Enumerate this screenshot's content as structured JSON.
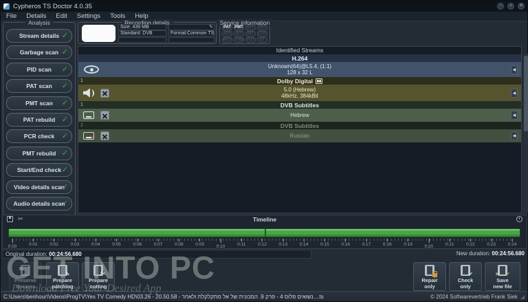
{
  "window": {
    "title": "Cypheros TS Doctor 4.0.35",
    "controls": {
      "minimize": "−",
      "maximize": "+",
      "close": "✕"
    }
  },
  "menu": [
    "File",
    "Details",
    "Edit",
    "Settings",
    "Tools",
    "Help"
  ],
  "analysis": {
    "title": "Analysis",
    "buttons": [
      "Stream details",
      "Garbage scan",
      "PID scan",
      "PAT scan",
      "PMT scan",
      "PAT rebuild",
      "PCR check",
      "PMT rebuild",
      "Start/End check",
      "Video details scan",
      "Audio details scan"
    ]
  },
  "recording": {
    "title": "Recording details",
    "size": "Size:  439 MB",
    "standard": "Standard: DVB",
    "format": "Format:Common TS"
  },
  "service": {
    "title": "Service information",
    "badges": [
      {
        "label": "PAT",
        "state": "on"
      },
      {
        "label": "PMT",
        "state": "on"
      },
      {
        "label": "EIT"
      },
      {
        "label": "SDT"
      },
      {
        "label": "TDT"
      },
      {
        "label": "SIT"
      },
      {
        "label": "NIT"
      },
      {
        "label": "CAT"
      },
      {
        "label": "RST"
      },
      {
        "label": "TSD"
      },
      {
        "label": "TOT"
      },
      {
        "label": "ST"
      }
    ]
  },
  "streams": {
    "panel_title": "Identified Streams",
    "video": {
      "codec": "H.264",
      "line1": "Unknown(64)@L5.4,  (1:1)",
      "line2": "128 x 32 L"
    },
    "audio": {
      "index": "1",
      "codec": "Dolby Digital",
      "line1": "5.0 (Hebrew)",
      "line2": "48kHz, 384kBit"
    },
    "sub1": {
      "index": "1",
      "codec": "DVB Subtitles",
      "line1": "Hebrew"
    },
    "sub2": {
      "index": "2",
      "codec": "DVB Subtitles",
      "line1": "Russian"
    }
  },
  "timeline": {
    "title": "Timeline",
    "ticks": [
      {
        "label": "0:00",
        "state": "major"
      },
      {
        "label": "0:01"
      },
      {
        "label": "0:02"
      },
      {
        "label": "0:03"
      },
      {
        "label": "0:04"
      },
      {
        "label": "0:05"
      },
      {
        "label": "0:06"
      },
      {
        "label": "0:07"
      },
      {
        "label": "0:08"
      },
      {
        "label": "0:09"
      },
      {
        "label": "0:10",
        "state": "major"
      },
      {
        "label": "0:11"
      },
      {
        "label": "0:12"
      },
      {
        "label": "0:13"
      },
      {
        "label": "0:14"
      },
      {
        "label": "0:15"
      },
      {
        "label": "0:16"
      },
      {
        "label": "0:17"
      },
      {
        "label": "0:18"
      },
      {
        "label": "0:19"
      },
      {
        "label": "0:20",
        "state": "major"
      },
      {
        "label": "0:21"
      },
      {
        "label": "0:22"
      },
      {
        "label": "0:23"
      },
      {
        "label": "0:24"
      }
    ]
  },
  "durations": {
    "original_label": "Original duration:",
    "original_value": "00:24:56.680",
    "new_label": "New duration:",
    "new_value": "00:24:56.680"
  },
  "actions": {
    "preserve": {
      "l1": "Preserve",
      "l2": "streams"
    },
    "patching": {
      "l1": "Prepare",
      "l2": "patching"
    },
    "cutting": {
      "l1": "Prepare",
      "l2": "cutting"
    },
    "repair": {
      "l1": "Repair",
      "l2": "only"
    },
    "check": {
      "l1": "Check",
      "l2": "only"
    },
    "save": {
      "l1": "Save",
      "l2": "new file"
    }
  },
  "statusbar": {
    "path": "C:\\Users\\benhour\\Videos\\ProgTV\\Yes TV Comedy HD\\03.26 - 20.50.58 - נשואים פלוס 4 - פרק 9. המכונית של אל מתקלקלת ולאחר....ts",
    "copyright": "© 2024 Softwarevertrieb Frank Siek"
  },
  "watermark": {
    "main": "GET INTO PC",
    "sub": "Download Free Your Desired App"
  },
  "glyphs": {
    "check": "✓",
    "collapse": "◀",
    "scissors": "✂",
    "pencil": "✎",
    "check_small": "✔",
    "cross": "✕",
    "grip": "◢"
  }
}
